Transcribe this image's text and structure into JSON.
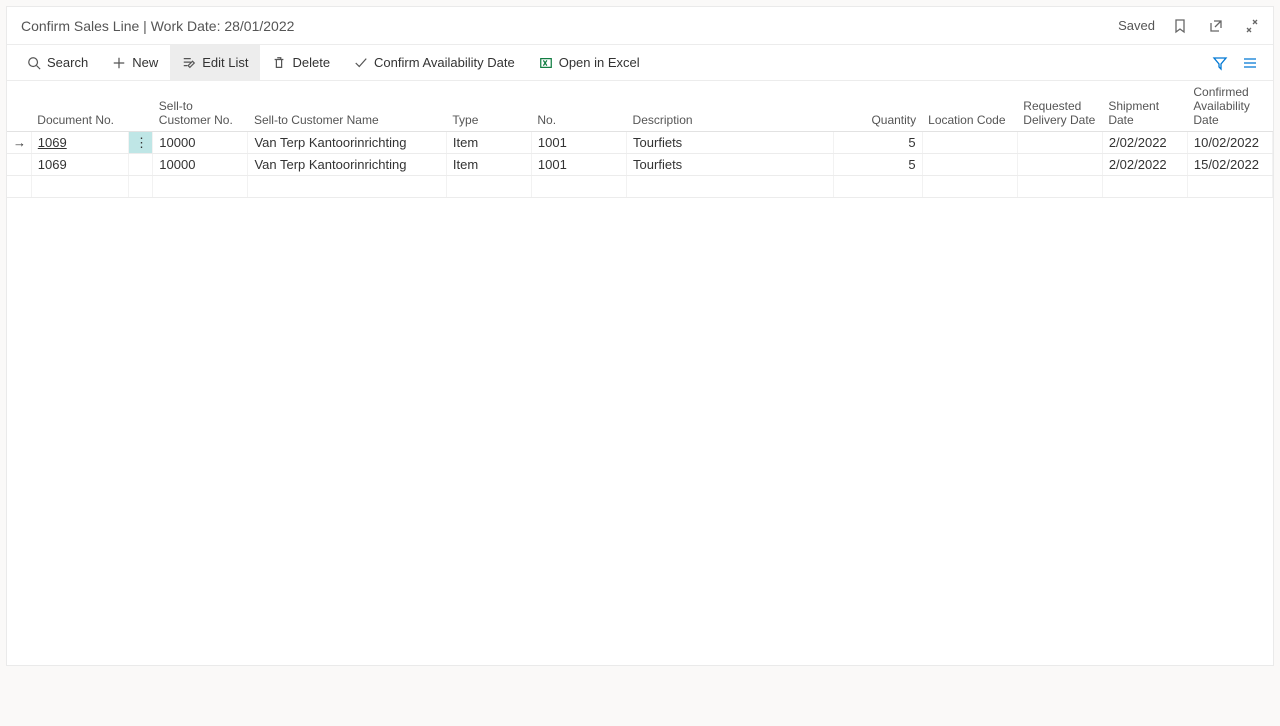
{
  "header": {
    "title": "Confirm Sales Line | Work Date: 28/01/2022",
    "saved_label": "Saved"
  },
  "toolbar": {
    "search": "Search",
    "new": "New",
    "edit_list": "Edit List",
    "delete": "Delete",
    "confirm": "Confirm Availability Date",
    "open_excel": "Open in Excel"
  },
  "columns": {
    "document_no": "Document No.",
    "sell_to_customer_no": "Sell-to Customer No.",
    "sell_to_customer_name": "Sell-to Customer Name",
    "type": "Type",
    "no": "No.",
    "description": "Description",
    "quantity": "Quantity",
    "location_code": "Location Code",
    "requested_delivery_date": "Requested Delivery Date",
    "shipment_date": "Shipment Date",
    "confirmed_availability_date": "Confirmed Availability Date"
  },
  "rows": [
    {
      "selected": true,
      "document_no": "1069",
      "sell_to_customer_no": "10000",
      "sell_to_customer_name": "Van Terp Kantoorinrichting",
      "type": "Item",
      "no": "1001",
      "description": "Tourfiets",
      "quantity": "5",
      "location_code": "",
      "requested_delivery_date": "",
      "shipment_date": "2/02/2022",
      "confirmed_availability_date": "10/02/2022"
    },
    {
      "selected": false,
      "document_no": "1069",
      "sell_to_customer_no": "10000",
      "sell_to_customer_name": "Van Terp Kantoorinrichting",
      "type": "Item",
      "no": "1001",
      "description": "Tourfiets",
      "quantity": "5",
      "location_code": "",
      "requested_delivery_date": "",
      "shipment_date": "2/02/2022",
      "confirmed_availability_date": "15/02/2022"
    }
  ]
}
